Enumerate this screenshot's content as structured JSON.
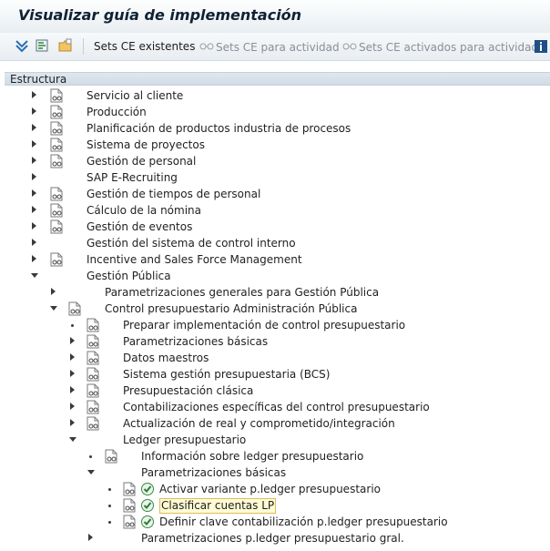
{
  "window": {
    "title": "Visualizar guía de implementación"
  },
  "toolbar": {
    "sets_existing": "Sets CE existentes",
    "sets_activity": "Sets CE para actividad",
    "sets_activated": "Sets CE activados para actividad"
  },
  "header": {
    "column": "Estructura"
  },
  "tree": {
    "items": [
      {
        "label": "Servicio al cliente"
      },
      {
        "label": "Producción"
      },
      {
        "label": "Planificación de productos industria de procesos"
      },
      {
        "label": "Sistema de proyectos"
      },
      {
        "label": "Gestión de personal"
      },
      {
        "label": "SAP E-Recruiting"
      },
      {
        "label": "Gestión de tiempos de personal"
      },
      {
        "label": "Cálculo de la nómina"
      },
      {
        "label": "Gestión de eventos"
      },
      {
        "label": "Gestión del sistema de control interno"
      },
      {
        "label": "Incentive and Sales Force Management"
      },
      {
        "label": "Gestión Pública"
      },
      {
        "label": "Parametrizaciones generales para Gestión Pública"
      },
      {
        "label": "Control presupuestario Administración Pública"
      },
      {
        "label": "Preparar implementación de control presupuestario"
      },
      {
        "label": "Parametrizaciones básicas"
      },
      {
        "label": "Datos maestros"
      },
      {
        "label": "Sistema gestión presupuestaria (BCS)"
      },
      {
        "label": "Presupuestación clásica"
      },
      {
        "label": "Contabilizaciones específicas del control presupuestario"
      },
      {
        "label": "Actualización de real y comprometido/integración"
      },
      {
        "label": "Ledger presupuestario"
      },
      {
        "label": "Información sobre ledger presupuestario"
      },
      {
        "label": "Parametrizaciones básicas"
      },
      {
        "label": "Activar variante p.ledger presupuestario"
      },
      {
        "label": "Clasificar cuentas LP"
      },
      {
        "label": "Definir clave contabilización p.ledger presupuestario"
      },
      {
        "label": "Parametrizaciones p.ledger presupuestario gral."
      }
    ]
  },
  "colors": {
    "selected_bg": "#fffbd4",
    "selected_border": "#e0ba5c",
    "header_bg": "#d8e1e9"
  }
}
